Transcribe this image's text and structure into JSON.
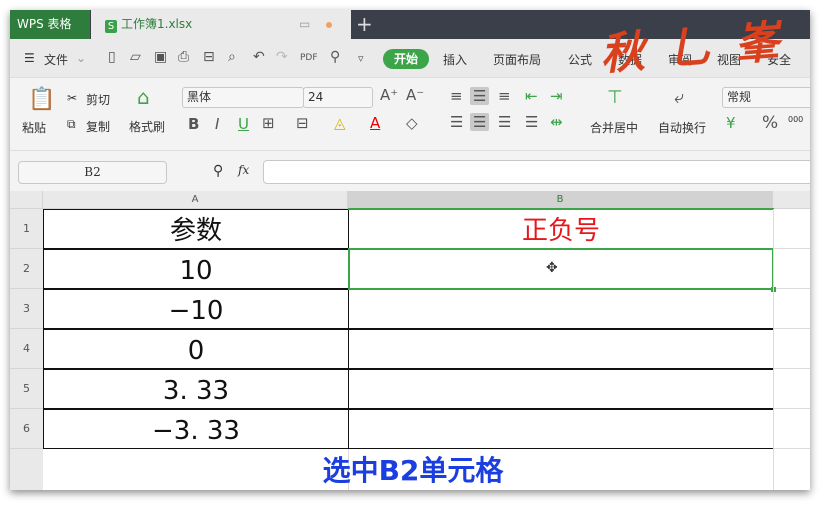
{
  "app": {
    "name": "WPS 表格",
    "doc_tab": "工作簿1.xlsx",
    "doc_icon": "S",
    "new_tab": "+"
  },
  "menu": {
    "file": "文件",
    "tabs": [
      "开始",
      "插入",
      "页面布局",
      "公式",
      "数据",
      "审阅",
      "视图",
      "安全"
    ]
  },
  "logo_text": "秋叶",
  "ribbon": {
    "paste": "粘贴",
    "cut": "剪切",
    "copy": "复制",
    "format_painter": "格式刷",
    "font_name": "黑体",
    "font_size": "24",
    "merge": "合并居中",
    "wrap": "自动换行",
    "number_format": "常规",
    "percent": "%",
    "thousands": "000"
  },
  "formula_bar": {
    "name_box": "B2",
    "fx": "fx",
    "value": ""
  },
  "sheet": {
    "columns": [
      "A",
      "B"
    ],
    "rows": [
      "1",
      "2",
      "3",
      "4",
      "5",
      "6"
    ],
    "cells": [
      [
        "参数",
        "正负号"
      ],
      [
        "10",
        ""
      ],
      [
        "−10",
        ""
      ],
      [
        "0",
        ""
      ],
      [
        "3. 33",
        ""
      ],
      [
        "−3. 33",
        ""
      ]
    ],
    "header_color": "#e8161b",
    "selected_cell": "B2"
  },
  "caption": "选中B2单元格"
}
